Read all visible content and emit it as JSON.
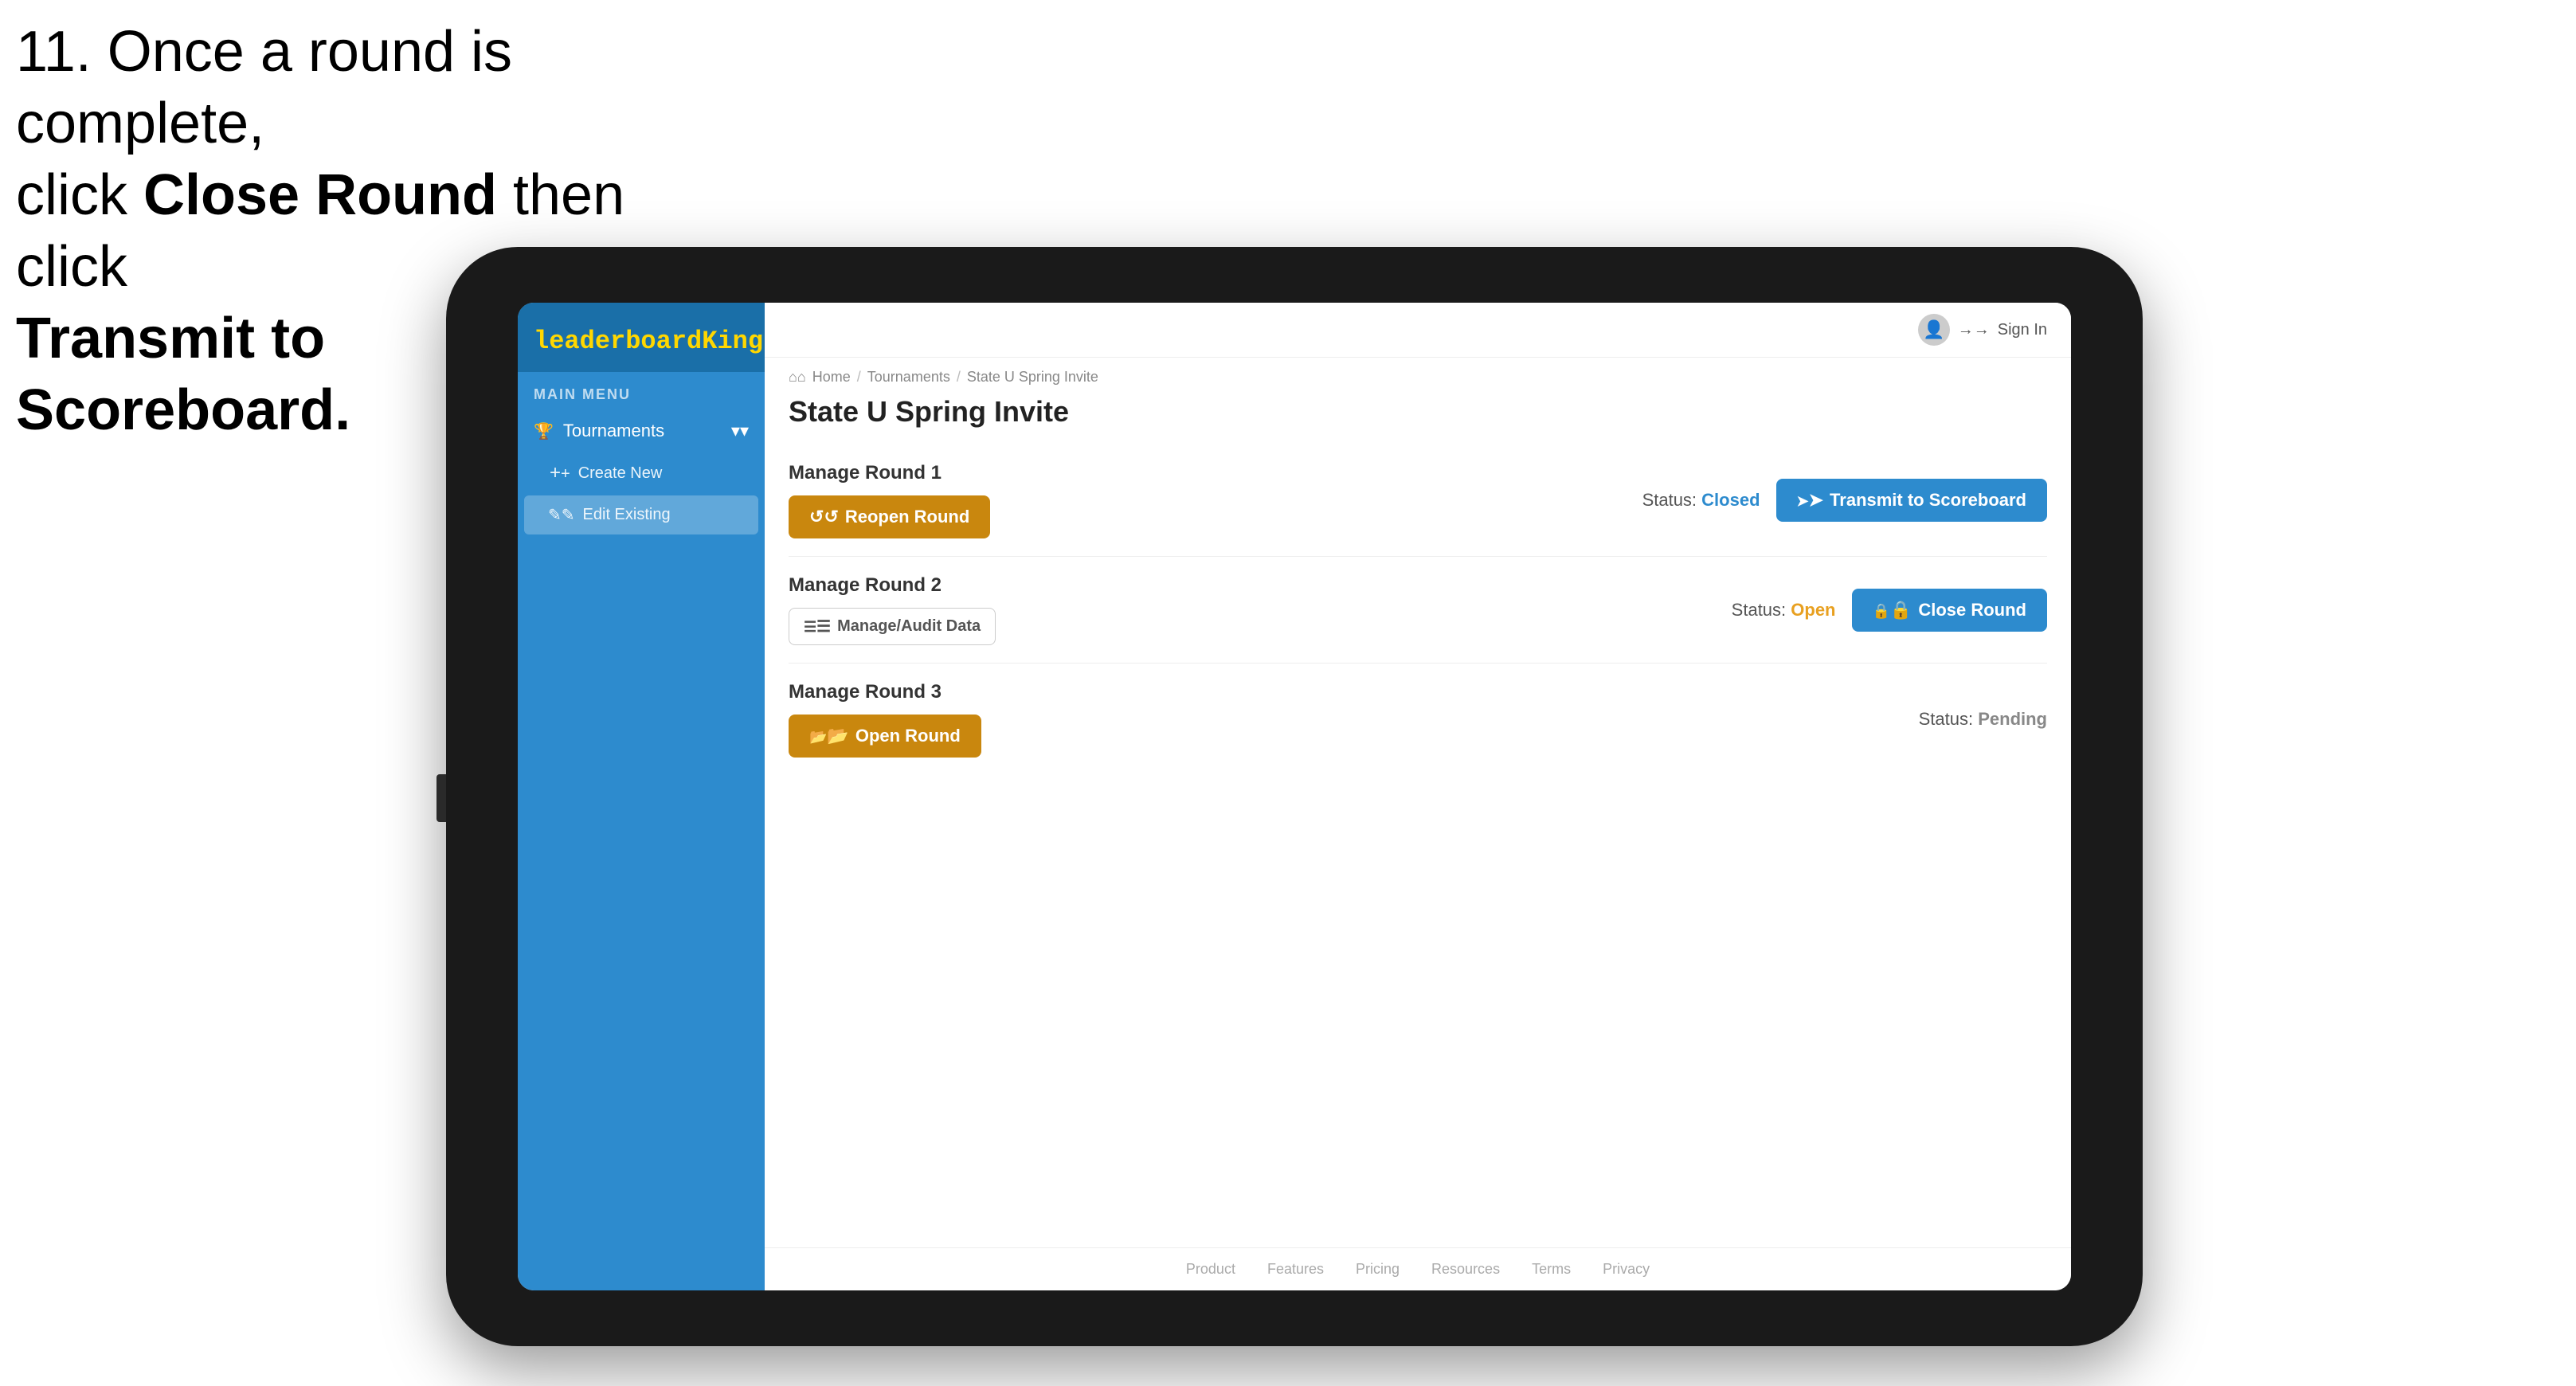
{
  "instruction": {
    "line1": "11. Once a round is complete,",
    "line2": "click ",
    "bold1": "Close Round",
    "line3": " then click",
    "bold2": "Transmit to Scoreboard."
  },
  "tablet": {
    "logo": {
      "leaderboard": "leaderboard",
      "king": "King"
    },
    "sidebar": {
      "main_menu_label": "MAIN MENU",
      "tournaments_label": "Tournaments",
      "create_new_label": "Create New",
      "edit_existing_label": "Edit Existing",
      "chevron": "▾"
    },
    "topbar": {
      "sign_in": "Sign In"
    },
    "breadcrumb": {
      "home": "Home",
      "sep1": "/",
      "tournaments": "Tournaments",
      "sep2": "/",
      "current": "State U Spring Invite"
    },
    "page_title": "State U Spring Invite",
    "rounds": [
      {
        "label": "Manage Round 1",
        "status_prefix": "Status: ",
        "status_value": "Closed",
        "status_class": "status-closed",
        "btn1_label": "Reopen Round",
        "btn2_label": "Transmit to Scoreboard"
      },
      {
        "label": "Manage Round 2",
        "status_prefix": "Status: ",
        "status_value": "Open",
        "status_class": "status-open",
        "btn1_label": "Manage/Audit Data",
        "btn2_label": "Close Round"
      },
      {
        "label": "Manage Round 3",
        "status_prefix": "Status: ",
        "status_value": "Pending",
        "status_class": "status-pending",
        "btn1_label": "Open Round",
        "btn2_label": ""
      }
    ],
    "footer": {
      "links": [
        "Product",
        "Features",
        "Pricing",
        "Resources",
        "Terms",
        "Privacy"
      ]
    }
  },
  "colors": {
    "sidebar_bg": "#2d8bce",
    "btn_gold": "#c9870e",
    "btn_blue": "#2d8bce",
    "status_closed": "#2d8bce",
    "status_open": "#e8a020",
    "status_pending": "#888888"
  }
}
